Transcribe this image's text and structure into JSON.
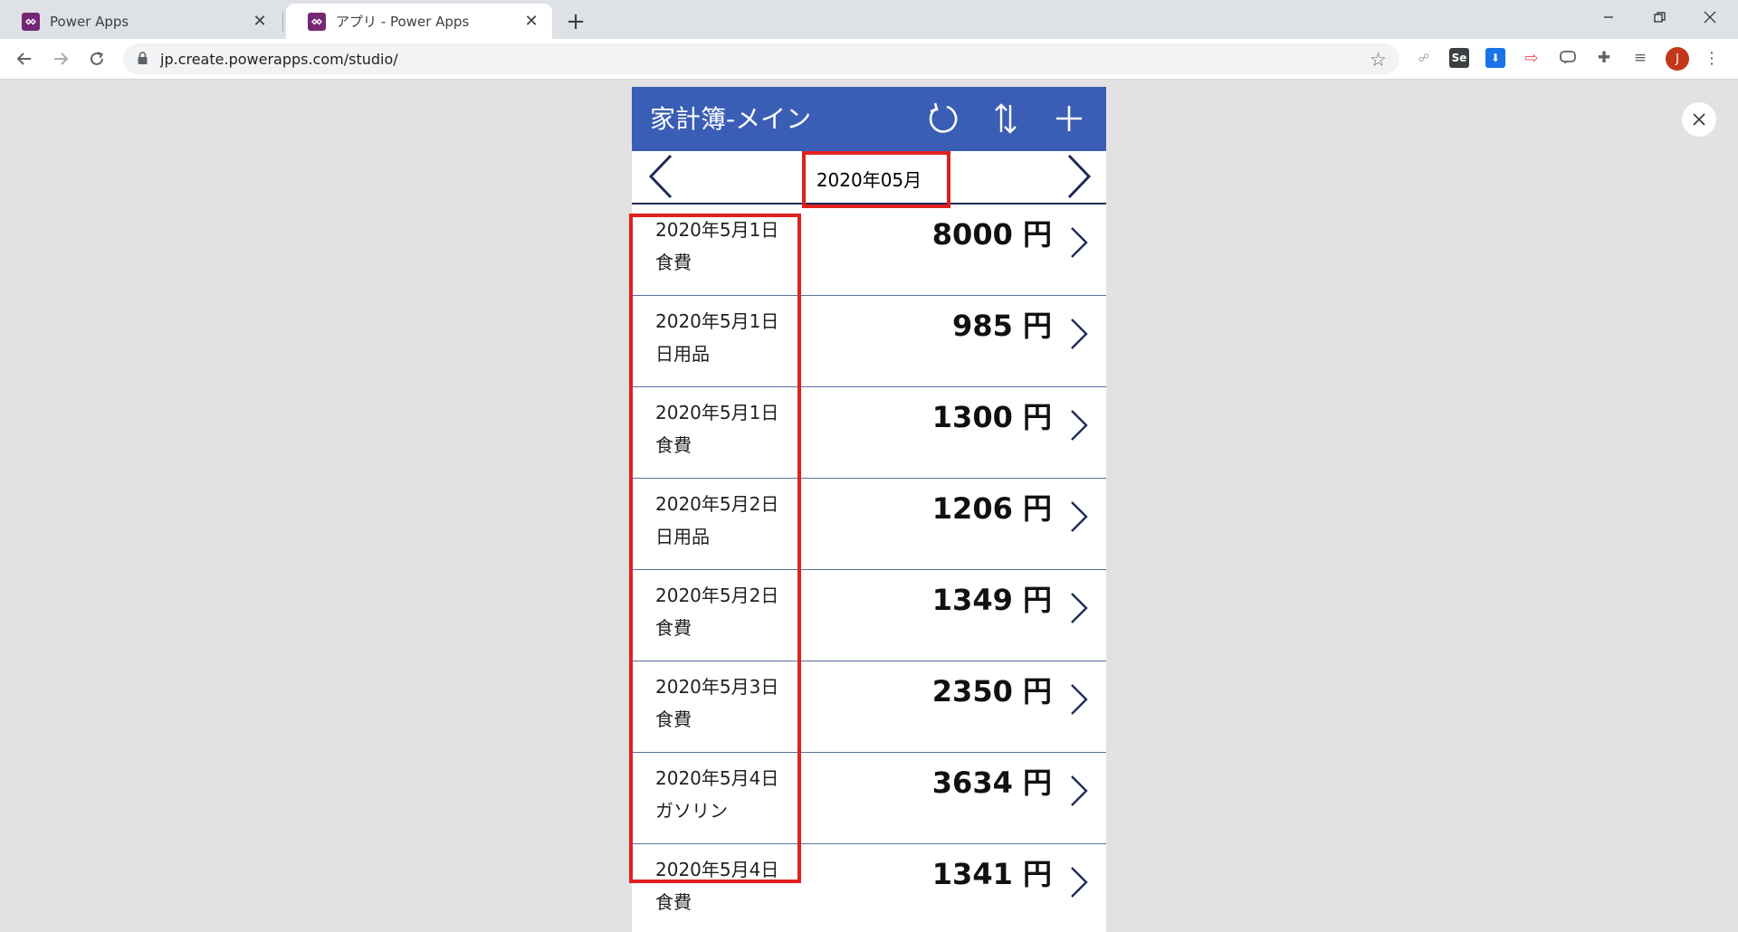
{
  "browser": {
    "tabs": [
      {
        "title": "Power Apps",
        "active": false
      },
      {
        "title": "アプリ - Power Apps",
        "active": true
      }
    ],
    "url": "jp.create.powerapps.com/studio/",
    "profile_initial": "J",
    "accent": "#742774"
  },
  "app": {
    "title": "家計簿-メイン",
    "header_color": "#3a5eb5",
    "month": "2020年05月",
    "entries": [
      {
        "date": "2020年5月1日",
        "category": "食費",
        "amount": "8000",
        "unit": "円"
      },
      {
        "date": "2020年5月1日",
        "category": "日用品",
        "amount": "985",
        "unit": "円"
      },
      {
        "date": "2020年5月1日",
        "category": "食費",
        "amount": "1300",
        "unit": "円"
      },
      {
        "date": "2020年5月2日",
        "category": "日用品",
        "amount": "1206",
        "unit": "円"
      },
      {
        "date": "2020年5月2日",
        "category": "食費",
        "amount": "1349",
        "unit": "円"
      },
      {
        "date": "2020年5月3日",
        "category": "食費",
        "amount": "2350",
        "unit": "円"
      },
      {
        "date": "2020年5月4日",
        "category": "ガソリン",
        "amount": "3634",
        "unit": "円"
      },
      {
        "date": "2020年5月4日",
        "category": "食費",
        "amount": "1341",
        "unit": "円"
      }
    ]
  },
  "annotation_color": "#e02020"
}
